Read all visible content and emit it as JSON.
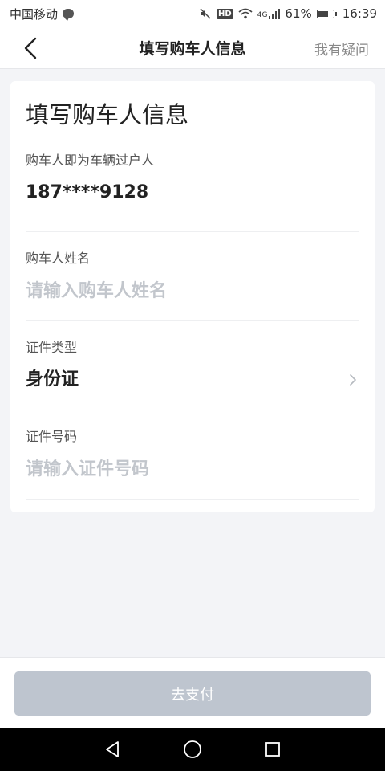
{
  "status_bar": {
    "carrier": "中国移动",
    "network": "4G",
    "battery": "61%",
    "time": "16:39",
    "hd": "HD"
  },
  "nav": {
    "title": "填写购车人信息",
    "help_label": "我有疑问"
  },
  "card": {
    "title": "填写购车人信息",
    "fields": [
      {
        "label": "购车人即为车辆过户人",
        "value": "187****9128"
      },
      {
        "label": "购车人姓名",
        "placeholder": "请输入购车人姓名"
      },
      {
        "label": "证件类型",
        "value": "身份证"
      },
      {
        "label": "证件号码",
        "placeholder": "请输入证件号码"
      }
    ]
  },
  "footer": {
    "pay_label": "去支付"
  },
  "colors": {
    "background": "#f3f4f7",
    "button_disabled": "#bec5cf",
    "placeholder": "#c2c6cc"
  }
}
